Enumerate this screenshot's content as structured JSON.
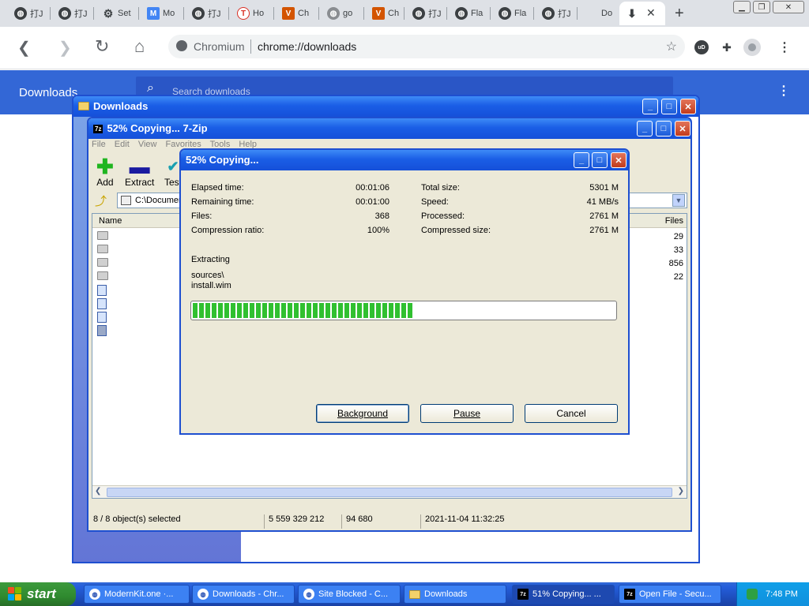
{
  "browser": {
    "tabs": [
      {
        "label": "打J",
        "icon": "globe-icon"
      },
      {
        "label": "打J",
        "icon": "globe-icon"
      },
      {
        "label": "Set",
        "icon": "gear-icon"
      },
      {
        "label": "Mo",
        "icon": "m-icon"
      },
      {
        "label": "打J",
        "icon": "globe-icon"
      },
      {
        "label": "Ho",
        "icon": "t-icon"
      },
      {
        "label": "Ch",
        "icon": "v-icon"
      },
      {
        "label": "go",
        "icon": "globe-grey-icon"
      },
      {
        "label": "Ch",
        "icon": "v-icon"
      },
      {
        "label": "打J",
        "icon": "globe-icon"
      },
      {
        "label": "Fla",
        "icon": "globe-icon"
      },
      {
        "label": "Fla",
        "icon": "globe-icon"
      },
      {
        "label": "打J",
        "icon": "globe-icon"
      },
      {
        "label": "Do",
        "icon": "windows-icon"
      }
    ],
    "active_tab_icon": "download-icon",
    "omnibox": {
      "site_label": "Chromium",
      "url": "chrome://downloads"
    },
    "downloads_page": {
      "title": "Downloads",
      "search_placeholder": "Search downloads"
    }
  },
  "explorer_window": {
    "title": "Downloads"
  },
  "zip_window": {
    "title": "52% Copying... 7-Zip",
    "menu": [
      "File",
      "Edit",
      "View",
      "Favorites",
      "Tools",
      "Help"
    ],
    "toolbar": [
      {
        "label": "Add",
        "icon": "plus-icon"
      },
      {
        "label": "Extract",
        "icon": "minus-icon"
      },
      {
        "label": "Test",
        "icon": "check-icon"
      }
    ],
    "address": "C:\\Documen",
    "columns": {
      "name": "Name",
      "files": "Files"
    },
    "file_counts": [
      "29",
      "33",
      "856",
      "22"
    ],
    "status": {
      "selected": "8 / 8 object(s) selected",
      "size": "5 559 329 212",
      "packed": "94 680",
      "modified": "2021-11-04 11:32:25"
    }
  },
  "progress_dialog": {
    "title": "52% Copying...",
    "left_stats": [
      {
        "label": "Elapsed time:",
        "value": "00:01:06"
      },
      {
        "label": "Remaining time:",
        "value": "00:01:00"
      },
      {
        "label": "Files:",
        "value": "368"
      },
      {
        "label": "Compression ratio:",
        "value": "100%"
      }
    ],
    "right_stats": [
      {
        "label": "Total size:",
        "value": "5301 M"
      },
      {
        "label": "Speed:",
        "value": "41 MB/s"
      },
      {
        "label": "Processed:",
        "value": "2761 M"
      },
      {
        "label": "Compressed size:",
        "value": "2761 M"
      }
    ],
    "operation": "Extracting",
    "path_line1": "sources\\",
    "path_line2": "install.wim",
    "progress_fraction": 0.52,
    "buttons": {
      "background": "Background",
      "pause": "Pause",
      "cancel": "Cancel"
    }
  },
  "taskbar": {
    "start_label": "start",
    "tasks": [
      {
        "label": "ModernKit.one ·...",
        "icon": "chromium-icon"
      },
      {
        "label": "Downloads - Chr...",
        "icon": "chromium-icon"
      },
      {
        "label": "Site Blocked - C...",
        "icon": "chromium-icon"
      },
      {
        "label": "Downloads",
        "icon": "folder-icon"
      },
      {
        "label": "51% Copying... ...",
        "icon": "7zip-icon"
      },
      {
        "label": "Open File - Secu...",
        "icon": "7zip-icon"
      }
    ],
    "clock": "7:48 PM"
  },
  "colors": {
    "xp_blue": "#1550d9",
    "chrome_blue": "#3367d6",
    "progress_green": "#30c030",
    "taskbar_blue": "#245edb",
    "start_green": "#2f8a2f"
  }
}
